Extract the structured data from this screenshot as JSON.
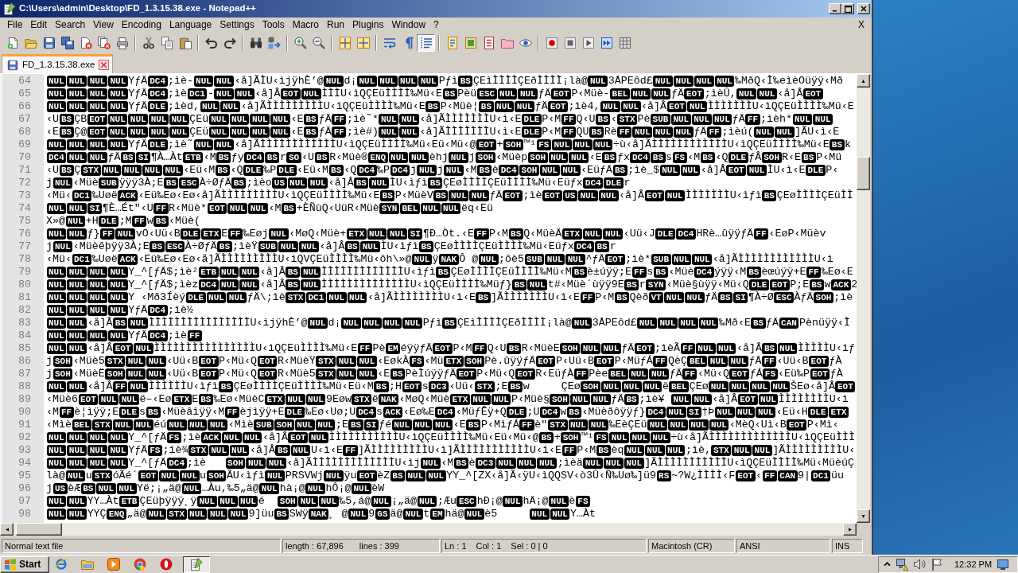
{
  "window": {
    "title": "C:\\Users\\admin\\Desktop\\FD_1.3.15.38.exe - Notepad++"
  },
  "menu": {
    "items": [
      {
        "label": "File"
      },
      {
        "label": "Edit"
      },
      {
        "label": "Search"
      },
      {
        "label": "View"
      },
      {
        "label": "Encoding"
      },
      {
        "label": "Language"
      },
      {
        "label": "Settings"
      },
      {
        "label": "Tools"
      },
      {
        "label": "Macro"
      },
      {
        "label": "Run"
      },
      {
        "label": "Plugins"
      },
      {
        "label": "Window"
      },
      {
        "label": "?"
      }
    ],
    "close_label": "X"
  },
  "toolbar": [
    [
      {
        "on": false
      },
      {
        "on": false
      },
      {
        "on": false
      },
      {
        "on": false
      },
      {
        "on": false
      },
      {
        "on": false
      },
      {
        "on": false
      }
    ],
    [
      {
        "on": false
      },
      {
        "on": false
      },
      {
        "on": false
      }
    ],
    [
      {
        "on": false
      },
      {
        "on": false
      }
    ],
    [
      {
        "on": false
      },
      {
        "on": false
      }
    ],
    [
      {
        "on": false
      },
      {
        "on": false
      }
    ],
    [
      {
        "on": false
      },
      {
        "on": false
      }
    ],
    [
      {
        "on": false
      },
      {
        "on": false
      },
      {
        "on": true
      }
    ],
    [
      {
        "on": false
      },
      {
        "on": false
      },
      {
        "on": false
      },
      {
        "on": false
      },
      {
        "on": false
      }
    ],
    [
      {
        "on": false
      },
      {
        "on": false
      },
      {
        "on": false
      },
      {
        "on": false
      },
      {
        "on": false
      }
    ]
  ],
  "tabs": [
    {
      "label": "FD_1.3.15.38.exe",
      "selected": true
    }
  ],
  "editor": {
    "lines": [
      {
        "number": "64",
        "parts": [
          [
            "NUL",
            "NUL",
            "NUL",
            "NUL"
          ],
          "YƒÄ",
          [
            "DC4"
          ],
          ";ìè-",
          [
            "NUL",
            "NUL"
          ],
          "‹å]ÃÌU‹ìjÿhÈ’@",
          [
            "NUL"
          ],
          "d¡",
          [
            "NUL",
            "NUL",
            "NUL",
            "NUL"
          ],
          "Pƒì",
          [
            "BS"
          ],
          "ÇEìÌÌÌÌÇEðÌÌÌÌ¡là@",
          [
            "NUL"
          ],
          "3ÅPEôd£",
          [
            "NUL",
            "NUL",
            "NUL",
            "NUL"
          ],
          "‰MðQ‹Ì‰eìèOüÿÿ‹Mð"
        ]
      },
      {
        "number": "65",
        "parts": [
          [
            "NUL",
            "NUL",
            "NUL",
            "NUL"
          ],
          "YƒÄ",
          [
            "DC4"
          ],
          ";ìè",
          [
            "DC1"
          ],
          "-",
          [
            "NUL",
            "NUL"
          ],
          "‹å]Â",
          [
            "EOT",
            "NUL"
          ],
          "ÌÌÌU‹ìQÇEüÌÌÌÌ‰Mü‹E",
          [
            "BS"
          ],
          "Pèü",
          [
            "ESC",
            "NUL",
            "NUL"
          ],
          "ƒÄ",
          [
            "EOT"
          ],
          "P‹Müè-",
          [
            "BEL",
            "NUL",
            "NUL"
          ],
          "ƒÄ",
          [
            "EOT"
          ],
          ";ìèÛ,",
          [
            "NUL",
            "NUL"
          ],
          "‹å]Â",
          [
            "EOT"
          ]
        ]
      },
      {
        "number": "66",
        "parts": [
          [
            "NUL",
            "NUL",
            "NUL",
            "NUL"
          ],
          "YƒÄ",
          [
            "DLE"
          ],
          ";ìèd,",
          [
            "NUL",
            "NUL"
          ],
          "‹å]ÃÌÌÌÌÌÌÌÌÌU‹ìQÇEüÌÌÌÌ‰Mü‹E",
          [
            "BS"
          ],
          "P‹Müè¦",
          [
            "BS",
            "NUL",
            "NUL"
          ],
          "ƒÄ",
          [
            "EOT"
          ],
          ";ìè4,",
          [
            "NUL",
            "NUL"
          ],
          "‹å]Â",
          [
            "EOT",
            "NUL"
          ],
          "ÌÌÌÌÌÌÌU‹ìQÇEüÌÌÌÌ‰Mü‹E"
        ]
      },
      {
        "number": "67",
        "parts": [
          "‹U",
          [
            "BS"
          ],
          "ÇB",
          [
            "EOT",
            "NUL",
            "NUL",
            "NUL",
            "NUL"
          ],
          "ÇEü",
          [
            "NUL",
            "NUL",
            "NUL",
            "NUL"
          ],
          "‹E",
          [
            "BS"
          ],
          "ƒÄ",
          [
            "FF"
          ],
          ";ìè˜*",
          [
            "NUL",
            "NUL"
          ],
          "‹å]ÃÌÌÌÌÌÌÌU‹ì‹E",
          [
            "DLE"
          ],
          "P‹M",
          [
            "FF"
          ],
          "Q‹U",
          [
            "BS"
          ],
          "‹",
          [
            "STX"
          ],
          "Pè",
          [
            "SUB",
            "NUL",
            "NUL",
            "NUL"
          ],
          "ƒÄ",
          [
            "FF"
          ],
          ";ìèh*",
          [
            "NUL",
            "NUL"
          ]
        ]
      },
      {
        "number": "68",
        "parts": [
          "‹E",
          [
            "BS"
          ],
          "Ç@",
          [
            "EOT",
            "NUL",
            "NUL",
            "NUL",
            "NUL"
          ],
          "ÇEü",
          [
            "NUL",
            "NUL",
            "NUL",
            "NUL"
          ],
          "‹E",
          [
            "BS"
          ],
          "ƒÄ",
          [
            "FF"
          ],
          ";ìè#)",
          [
            "NUL",
            "NUL"
          ],
          "‹å]ÃÌÌÌÌÌÌÌU‹ì‹E",
          [
            "DLE"
          ],
          "P‹M",
          [
            "FF"
          ],
          "QU",
          [
            "BS"
          ],
          "Rè",
          [
            "FF",
            "NUL",
            "NUL",
            "NUL"
          ],
          "ƒÄ",
          [
            "FF"
          ],
          ";ìèú(",
          [
            "NUL",
            "NUL"
          ],
          "]ÃU‹ì‹E"
        ]
      },
      {
        "number": "69",
        "parts": [
          [
            "NUL",
            "NUL",
            "NUL",
            "NUL"
          ],
          "YƒÄ",
          [
            "DLE"
          ],
          ";ìè˜",
          [
            "NUL",
            "NUL"
          ],
          "‹å]ÃÌÌÌÌÌÌÌÌÌÌÌÌU‹ìQÇEüÌÌÌÌ‰Mü‹Eü‹Mü‹@",
          [
            "EOT"
          ],
          "+",
          [
            "SOH"
          ],
          "™¹",
          [
            "FS",
            "NUL",
            "NUL",
            "NUL"
          ],
          "÷ù‹å]ÃÌÌÌÌÌÌÌÌÌÌÌÌU‹ìQÇEüÌÌÌÌ‰Mü‹E",
          [
            "BS"
          ],
          "k"
        ]
      },
      {
        "number": "70",
        "parts": [
          [
            "DC4",
            "NUL",
            "NUL"
          ],
          "ƒÄ",
          [
            "BS",
            "SI"
          ],
          "¶À…Àt",
          [
            "ETB"
          ],
          "‹M",
          [
            "BS"
          ],
          "ƒy",
          [
            "DC4",
            "BS"
          ],
          "r",
          [
            "SO"
          ],
          "‹U",
          [
            "BS"
          ],
          "R‹Müè®",
          [
            "ENQ",
            "NUL",
            "NUL"
          ],
          "èhj",
          [
            "NUL"
          ],
          "j",
          [
            "SOH"
          ],
          "‹Müèp",
          [
            "SOH",
            "NUL",
            "NUL"
          ],
          "‹E",
          [
            "BS"
          ],
          "ƒx",
          [
            "DC4",
            "BS"
          ],
          "s",
          [
            "FS"
          ],
          "‹M",
          [
            "BS"
          ],
          "‹Q",
          [
            "DLE"
          ],
          "ƒÂ",
          [
            "SOH"
          ],
          "R‹E",
          [
            "BS"
          ],
          "P‹Mü"
        ]
      },
      {
        "number": "71",
        "parts": [
          "‹U",
          [
            "BS"
          ],
          "Ç",
          [
            "STX",
            "NUL",
            "NUL",
            "NUL",
            "NUL"
          ],
          "‹Eü‹M",
          [
            "BS"
          ],
          "‹Q",
          [
            "DLE"
          ],
          "‰P",
          [
            "DLE"
          ],
          "‹Eü‹M",
          [
            "BS"
          ],
          "‹Q",
          [
            "DC4"
          ],
          "‰P",
          [
            "DC4"
          ],
          "j",
          [
            "NUL"
          ],
          "j",
          [
            "NUL"
          ],
          "‹M",
          [
            "BS"
          ],
          "è",
          [
            "DC4",
            "SOH",
            "NUL",
            "NUL"
          ],
          "‹EüƒÄ",
          [
            "BS"
          ],
          ";ìè_$",
          [
            "NUL",
            "NUL"
          ],
          "‹å]Â",
          [
            "EOT",
            "NUL"
          ],
          "ÌU‹ì‹E",
          [
            "DLE"
          ],
          "P‹"
        ]
      },
      {
        "number": "72",
        "parts": [
          "j",
          [
            "NUL"
          ],
          "‹Müè",
          [
            "SUB"
          ],
          "ÿÿÿ3À;E",
          [
            "BS",
            "ESC"
          ],
          "À÷ØƒÄ",
          [
            "BS"
          ],
          ";ìèo",
          [
            "US",
            "NUL",
            "NUL"
          ],
          "‹å]Â",
          [
            "BS",
            "NUL"
          ],
          "ÌU‹ìƒì",
          [
            "BS"
          ],
          "ÇEøÌÌÌÌÇEüÌÌÌÌ‰Mü‹Eüƒx",
          [
            "DC4",
            "DLE"
          ],
          "r"
        ]
      },
      {
        "number": "73",
        "parts": [
          "‹Mü‹",
          [
            "DC1"
          ],
          "‰Uøë",
          [
            "ACK"
          ],
          "‹Eü‰Eø‹Eø‹å]ÃÌÌÌÌÌÌÌÌÌU‹ìQÇEüÌÌÌÌ‰Mü‹E",
          [
            "BS"
          ],
          "P‹MüèV",
          [
            "BS",
            "NUL",
            "NUL"
          ],
          "ƒÄ",
          [
            "EOT"
          ],
          ";ìè",
          [
            "EOT",
            "US",
            "NUL",
            "NUL"
          ],
          "‹å]Â",
          [
            "EOT",
            "NUL"
          ],
          "ÌÌÌÌÌÌÌU‹ìƒì",
          [
            "BS"
          ],
          "ÇEøÌÌÌÌÇEüÌÌ"
        ]
      },
      {
        "number": "74",
        "parts": [
          [
            "NUL",
            "NUL",
            "SI"
          ],
          "¶È…Ét\"‹U",
          [
            "FF"
          ],
          "R‹Müè*",
          [
            "EOT",
            "NUL",
            "NUL"
          ],
          "‹M",
          [
            "BS"
          ],
          "+ÈÑùQ‹UüR‹Müè",
          [
            "SYN",
            "BEL",
            "NUL",
            "NUL"
          ],
          "ëq‹Eü"
        ]
      },
      {
        "number": "75",
        "parts": [
          "X»@",
          [
            "NUL"
          ],
          "+H",
          [
            "DLE"
          ],
          ";M",
          [
            "FF"
          ],
          "w",
          [
            "BS"
          ],
          "‹Müè("
        ]
      },
      {
        "number": "76",
        "parts": [
          [
            "NUL",
            "NUL"
          ],
          "ƒ}",
          [
            "FF",
            "NUL"
          ],
          "vO‹Uü‹B",
          [
            "DLE",
            "ETX"
          ],
          "E",
          [
            "FF"
          ],
          "‰Eøj",
          [
            "NUL"
          ],
          "‹MøQ‹Müè+",
          [
            "ETX",
            "NUL",
            "NUL",
            "SI"
          ],
          "¶Ð…Òt.‹E",
          [
            "FF"
          ],
          "P‹M",
          [
            "BS"
          ],
          "Q‹MüèÄ",
          [
            "ETX",
            "NUL",
            "NUL"
          ],
          "‹Uü‹J",
          [
            "DLE",
            "DC4"
          ],
          "HRè…ûÿÿƒÄ",
          [
            "FF"
          ],
          "‹EøP‹Müèv"
        ]
      },
      {
        "number": "77",
        "parts": [
          "j",
          [
            "NUL"
          ],
          "‹Müèêþÿÿ3À;E",
          [
            "BS",
            "ESC"
          ],
          "À÷ØƒÄ",
          [
            "BS"
          ],
          ";ìèŸ",
          [
            "SUB",
            "NUL",
            "NUL"
          ],
          "‹å]Â",
          [
            "BS",
            "NUL"
          ],
          "ÌU‹ìƒì",
          [
            "BS"
          ],
          "ÇEøÌÌÌÌÇEüÌÌÌÌ‰Mü‹Eüƒx",
          [
            "DC4",
            "BS"
          ],
          "r"
        ]
      },
      {
        "number": "78",
        "parts": [
          "‹Mü‹",
          [
            "DC1"
          ],
          "‰Uøë",
          [
            "ACK"
          ],
          "‹Eü‰Eø‹Eø‹å]ÃÌÌÌÌÌÌÌÌÌU‹ìQVÇEüÌÌÌÌ‰Mü‹ôh\\»@",
          [
            "NUL"
          ],
          "ÿ",
          [
            "NAK"
          ],
          "Ô @",
          [
            "NUL"
          ],
          ";ôè5",
          [
            "SUB",
            "NUL",
            "NUL"
          ],
          "^ƒÄ",
          [
            "EOT"
          ],
          ";ìè*",
          [
            "SUB",
            "NUL",
            "NUL"
          ],
          "‹å]ÃÌÌÌÌÌÌÌÌÌÌÌÌU‹ì"
        ]
      },
      {
        "number": "79",
        "parts": [
          [
            "NUL",
            "NUL",
            "NUL",
            "NUL"
          ],
          "Y_^[ƒÄ$;ìè²",
          [
            "ETB",
            "NUL",
            "NUL"
          ],
          "‹å]Â",
          [
            "BS",
            "NUL"
          ],
          "ÌÌÌÌÌÌÌÌÌÌÌÌÌU‹ìƒì",
          [
            "BS"
          ],
          "ÇEøÌÌÌÌÇEüÌÌÌÌ‰Mü‹M",
          [
            "BS"
          ],
          "è±úÿÿ;E",
          [
            "FF"
          ],
          "s",
          [
            "BS"
          ],
          "‹Müè",
          [
            "DC4"
          ],
          "ýÿÿ‹M",
          [
            "BS"
          ],
          "èœúÿÿ+E",
          [
            "FF"
          ],
          "‰Eø‹E"
        ]
      },
      {
        "number": "80",
        "parts": [
          [
            "NUL",
            "NUL",
            "NUL",
            "NUL"
          ],
          "Y_^[ƒÄ$;ìèz",
          [
            "DC4",
            "NUL",
            "NUL"
          ],
          "‹å]Â",
          [
            "BS",
            "NUL"
          ],
          "ÌÌÌÌÌÌÌÌÌÌÌÌÌÌU‹ìQÇEüÌÌÌÌ‰Müƒ}",
          [
            "BS",
            "NUL"
          ],
          "t#‹Müè´ùÿÿ9E",
          [
            "BS"
          ],
          "r",
          [
            "SYN"
          ],
          "‹Müè§ùÿÿ‹Mü‹Q",
          [
            "DLE",
            "EOT"
          ],
          "P;E",
          [
            "BS"
          ],
          "w",
          [
            "ACK"
          ],
          "2"
        ]
      },
      {
        "number": "81",
        "parts": [
          [
            "NUL",
            "NUL",
            "NUL",
            "NUL"
          ],
          "Y ‹Mð3Íèý",
          [
            "DLE",
            "NUL",
            "NUL"
          ],
          "ƒÄ\\;ìè",
          [
            "STX",
            "DC1",
            "NUL",
            "NUL"
          ],
          "‹å]ÃÌÌÌÌÌÌÌÌU‹ì‹E",
          [
            "BS"
          ],
          "]ÃÌÌÌÌÌÌÌU‹ì‹E",
          [
            "FF"
          ],
          "P‹M",
          [
            "BS"
          ],
          "Qèð",
          [
            "VT",
            "NUL",
            "NUL"
          ],
          "ƒÄ",
          [
            "BS",
            "SI"
          ],
          "¶À÷Ø",
          [
            "ESC"
          ],
          "ÀƒÄ",
          [
            "SOH"
          ],
          ";ìè"
        ]
      },
      {
        "number": "82",
        "parts": [
          [
            "NUL",
            "NUL",
            "NUL",
            "NUL"
          ],
          "YƒÄ",
          [
            "DC4"
          ],
          ";ìè½"
        ]
      },
      {
        "number": "83",
        "parts": [
          [
            "NUL",
            "NUL"
          ],
          "‹å]Â",
          [
            "BS",
            "NUL"
          ],
          "ÌÌÌÌÌÌÌÌÌÌÌÌÌÌÌÌU‹ìjÿhÈ’@",
          [
            "NUL"
          ],
          "d¡",
          [
            "NUL",
            "NUL",
            "NUL",
            "NUL"
          ],
          "Pƒì",
          [
            "BS"
          ],
          "ÇEìÌÌÌÌÇEðÌÌÌÌ¡là@",
          [
            "NUL"
          ],
          "3ÅPEôd£",
          [
            "NUL",
            "NUL",
            "NUL",
            "NUL"
          ],
          "‰Mð‹E",
          [
            "BS"
          ],
          "ƒÄ",
          [
            "CAN"
          ],
          "Pènüÿÿ‹Ì"
        ]
      },
      {
        "number": "84",
        "parts": [
          [
            "NUL",
            "NUL",
            "NUL",
            "NUL"
          ],
          "YƒÄ",
          [
            "DC4"
          ],
          ";ìè",
          [
            "FF"
          ]
        ]
      },
      {
        "number": "85",
        "parts": [
          [
            "NUL",
            "NUL"
          ],
          "‹å]Â",
          [
            "EOT",
            "NUL"
          ],
          "ÌÌÌÌÌÌÌÌÌÌÌÌÌÌÌÌU‹ìQÇEüÌÌÌÌ‰Mü‹E",
          [
            "FF"
          ],
          "Pè",
          [
            "EM"
          ],
          "éÿÿƒÄ",
          [
            "EOT"
          ],
          "P‹M",
          [
            "FF"
          ],
          "Q‹U",
          [
            "BS"
          ],
          "R‹MüèE",
          [
            "SOH",
            "NUL",
            "NUL"
          ],
          "ƒÄ",
          [
            "EOT"
          ],
          ";ìèÃ",
          [
            "FF",
            "NUL",
            "NUL"
          ],
          "‹å]Â",
          [
            "BS",
            "NUL"
          ],
          "ÌÌÌÌÌU‹ìƒ"
        ]
      },
      {
        "number": "86",
        "parts": [
          "j",
          [
            "SOH"
          ],
          "‹Müè5",
          [
            "STX",
            "NUL",
            "NUL"
          ],
          "‹Uü‹B",
          [
            "EOT"
          ],
          "P‹Mü‹Q",
          [
            "EOT"
          ],
          "R‹MüèŸ",
          [
            "STX",
            "NUL",
            "NUL"
          ],
          "‹EøkÀ",
          [
            "FS"
          ],
          "‹Mü",
          [
            "ETX",
            "SOH"
          ],
          "Pè.ûÿÿƒÄ",
          [
            "EOT"
          ],
          "P‹Uü‹B",
          [
            "EOT"
          ],
          "P‹MüƒÁ",
          [
            "FF"
          ],
          "QèÇ",
          [
            "BEL",
            "NUL",
            "NUL"
          ],
          "ƒÄ",
          [
            "FF"
          ],
          "‹Uü‹B",
          [
            "EOT"
          ],
          "ƒÀ"
        ]
      },
      {
        "number": "87",
        "parts": [
          "j",
          [
            "SOH"
          ],
          "‹MüèË",
          [
            "SOH",
            "NUL",
            "NUL"
          ],
          "‹Uü‹B",
          [
            "EOT"
          ],
          "P‹Mü‹Q",
          [
            "EOT"
          ],
          "R‹Müè5",
          [
            "STX",
            "NUL",
            "NUL"
          ],
          "‹E",
          [
            "BS"
          ],
          "PèÌúÿÿƒÄ",
          [
            "EOT"
          ],
          "P‹Mü‹Q",
          [
            "EOT"
          ],
          "R‹EüƒÀ",
          [
            "FF"
          ],
          "Pèe",
          [
            "BEL",
            "NUL",
            "NUL"
          ],
          "ƒÄ",
          [
            "FF"
          ],
          "‹Mü‹Q",
          [
            "EOT"
          ],
          "ƒÁ",
          [
            "FS"
          ],
          "‹Eü‰P",
          [
            "EOT"
          ],
          "ƒÀ"
        ]
      },
      {
        "number": "88",
        "parts": [
          [
            "NUL",
            "NUL"
          ],
          "‹å]Â",
          [
            "FF",
            "NUL"
          ],
          "ÌÌÌÌÌÌU‹ìƒì",
          [
            "BS"
          ],
          "ÇEøÌÌÌÌÇEüÌÌÌÌ‰Mü‹Eü‹M",
          [
            "BS"
          ],
          ";H",
          [
            "EOT"
          ],
          "s",
          [
            "DC3"
          ],
          "‹Uü‹",
          [
            "STX"
          ],
          ";E",
          [
            "BS"
          ],
          "w     ÇEø",
          [
            "SOH",
            "NUL",
            "NUL",
            "NUL"
          ],
          "ë",
          [
            "BEL"
          ],
          "ÇEø",
          [
            "NUL",
            "NUL",
            "NUL",
            "NUL"
          ],
          "ŠEø‹å]Â",
          [
            "EOT"
          ]
        ]
      },
      {
        "number": "89",
        "parts": [
          "‹Müè6",
          [
            "EOT",
            "NUL",
            "NUL"
          ],
          "ë–‹Eø",
          [
            "ETX"
          ],
          "E",
          [
            "BS"
          ],
          "‰Eø‹MüèC",
          [
            "ETX",
            "NUL",
            "NUL"
          ],
          "9Eøw",
          [
            "STX"
          ],
          "ë",
          [
            "NAK"
          ],
          "‹MøQ‹Müè",
          [
            "ETX",
            "NUL",
            "NUL"
          ],
          "P‹Müè§",
          [
            "SOH",
            "NUL",
            "NUL"
          ],
          "ƒÄ",
          [
            "BS"
          ],
          ";ìè¥ ",
          [
            "NUL",
            "NUL"
          ],
          "‹å]Â",
          [
            "EOT",
            "NUL"
          ],
          "ÌÌÌÌÌÌÌÌU‹ì"
        ]
      },
      {
        "number": "90",
        "parts": [
          "‹M",
          [
            "FF"
          ],
          "è¦ìÿÿ;E",
          [
            "DLE"
          ],
          "s",
          [
            "BS"
          ],
          "‹Müèâìÿÿ‹M",
          [
            "FF"
          ],
          "èjìÿÿ+E",
          [
            "DLE"
          ],
          "‰Eø‹Uø;U",
          [
            "DC4"
          ],
          "s",
          [
            "ACK"
          ],
          "‹Eø‰E",
          [
            "DC4"
          ],
          "‹MüƒÊÿ+Q",
          [
            "DLE"
          ],
          ";U",
          [
            "DC4"
          ],
          "w",
          [
            "BS"
          ],
          "‹Müèðôÿÿƒ}",
          [
            "DC4",
            "NUL",
            "SI"
          ],
          "†Þ",
          [
            "NUL",
            "NUL",
            "NUL"
          ],
          "‹Eü‹H",
          [
            "DLE",
            "ETX"
          ]
        ]
      },
      {
        "number": "91",
        "parts": [
          "‹Mìè",
          [
            "BEL",
            "STX",
            "NUL",
            "NUL"
          ],
          "éú",
          [
            "NUL",
            "NUL",
            "NUL"
          ],
          "‹Mìè",
          [
            "SUB",
            "SOH",
            "NUL",
            "NUL"
          ],
          ";E",
          [
            "BS",
            "SI"
          ],
          "ƒé",
          [
            "NUL",
            "NUL",
            "NUL"
          ],
          "‹E",
          [
            "BS"
          ],
          "P‹MìƒÁ",
          [
            "FF"
          ],
          "è\"",
          [
            "STX",
            "NUL",
            "NUL"
          ],
          "‰EèÇEü",
          [
            "NUL",
            "NUL",
            "NUL",
            "NUL"
          ],
          "‹MèQ‹Uì‹B",
          [
            "EOT"
          ],
          "P‹Mì‹"
        ]
      },
      {
        "number": "92",
        "parts": [
          [
            "NUL",
            "NUL",
            "NUL",
            "NUL"
          ],
          "Y_^[ƒÄ",
          [
            "FS"
          ],
          ";ìè",
          [
            "ACK",
            "NUL",
            "NUL"
          ],
          "‹å]Â",
          [
            "EOT",
            "NUL"
          ],
          "ÌÌÌÌÌÌÌÌÌÌÌU‹ìQÇEüÌÌÌÌ‰Mü‹Eü‹Mü‹@",
          [
            "BS"
          ],
          "+",
          [
            "SOH"
          ],
          "™¹",
          [
            "FS",
            "NUL",
            "NUL",
            "NUL"
          ],
          "÷ù‹å]ÃÌÌÌÌÌÌÌÌÌÌÌÌÌU‹ìQÇEüÌÌÌ"
        ]
      },
      {
        "number": "93",
        "parts": [
          [
            "NUL",
            "NUL",
            "NUL",
            "NUL"
          ],
          "YƒÄ",
          [
            "FS"
          ],
          ";ìè¾",
          [
            "STX",
            "NUL",
            "NUL"
          ],
          "‹å]Â",
          [
            "BS",
            "NUL"
          ],
          "U‹ì‹E",
          [
            "FF"
          ],
          "]ÃÌÌÌÌÌÌÌÌÌU‹ì]ÃÌÌÌÌÌÌÌÌÌÌÌU‹ì‹E",
          [
            "FF"
          ],
          "P‹M",
          [
            "BS"
          ],
          "èq",
          [
            "NUL",
            "NUL",
            "NUL"
          ],
          ";ìè,",
          [
            "STX",
            "NUL",
            "NUL"
          ],
          "]ÃÌÌÌÌÌÌÌÌÌU‹"
        ]
      },
      {
        "number": "94",
        "parts": [
          [
            "NUL",
            "NUL",
            "NUL",
            "NUL"
          ],
          "Y_^[ƒÄ",
          [
            "DC4"
          ],
          ";ìè   ",
          [
            "SOH",
            "NUL",
            "NUL"
          ],
          "‹å]ÃÌÌÌÌÌÌÌÌÌÌÌÌÌU‹ìj",
          [
            "NUL"
          ],
          "‹M",
          [
            "BS"
          ],
          "è",
          [
            "DC3",
            "NUL",
            "NUL",
            "NUL"
          ],
          ";ìèä",
          [
            "NUL",
            "NUL",
            "NUL"
          ],
          "]ÃÌÌÌÌÌÌÌÌÌÌÌU‹ìQÇEüÌÌÌÌ‰Mü‹MüèúÇ"
        ]
      },
      {
        "number": "95",
        "parts": [
          "là@",
          [
            "NUL"
          ],
          "u",
          [
            "STX"
          ],
          "óÃé´",
          [
            "EOT",
            "NUL",
            "NUL"
          ],
          "u",
          [
            "SOH"
          ],
          "ÃU‹ìƒì",
          [
            "NUL"
          ],
          "PRSVWj",
          [
            "NUL"
          ],
          "ÿu",
          [
            "EOT"
          ],
          "èZ",
          [
            "BS",
            "NUL",
            "NUL"
          ],
          "YY_^[ZX‹å]Ã",
          "‹ÿU‹ìQQSV‹ò3Û‹Ñ‰Uø‰]ü9",
          [
            "RS"
          ],
          "~?W¿ÌÌÌÌ‹F",
          [
            "EOT"
          ],
          "‹",
          [
            "FF",
            "CAN"
          ],
          "9|",
          [
            "DC1"
          ],
          "üu"
        ]
      },
      {
        "number": "96",
        "parts": [
          "j",
          [
            "US"
          ],
          "èÆ",
          [
            "BS",
            "NUL",
            "NUL"
          ],
          "Yë;¡„ä@",
          [
            "NUL"
          ],
          "…Àu,‰5„ä@",
          [
            "NUL"
          ],
          "hà¡@",
          [
            "NUL"
          ],
          "hÔ¡@",
          [
            "NUL"
          ],
          "èW"
        ]
      },
      {
        "number": "97",
        "parts": [
          [
            "NUL",
            "NUL"
          ],
          "YY…Àt",
          [
            "ETB"
          ],
          "ÇEüþÿÿÿ¸ÿ",
          [
            "NUL",
            "NUL",
            "NUL"
          ],
          "é  ",
          [
            "SOH",
            "NUL",
            "NUL"
          ],
          "‰5,á@",
          [
            "NUL"
          ],
          "¡„ä@",
          [
            "NUL"
          ],
          ";Æu",
          [
            "ESC"
          ],
          "hÐ¡@",
          [
            "NUL"
          ],
          "hÄ¡@",
          [
            "NUL"
          ],
          "è",
          [
            "FS"
          ]
        ]
      },
      {
        "number": "98",
        "parts": [
          [
            "NUL",
            "NUL"
          ],
          "YYÇ",
          [
            "ENQ"
          ],
          "„ä@",
          [
            "NUL",
            "STX",
            "NUL",
            "NUL",
            "NUL"
          ],
          "9]üu",
          [
            "BS"
          ],
          "SWÿ",
          [
            "NAK"
          ],
          "¸ @",
          [
            "NUL"
          ],
          "9",
          [
            "GS"
          ],
          "ä@",
          [
            "NUL"
          ],
          "t",
          [
            "EM"
          ],
          "hä@",
          [
            "NUL"
          ],
          "è5     ",
          [
            "NUL",
            "NUL"
          ],
          "Y…Àt"
        ]
      }
    ]
  },
  "status_bar": {
    "file_type": "Normal text file",
    "length": "length : 67,896",
    "line_count": "lines : 399",
    "position": "Ln : 1",
    "column": "Col : 1",
    "selection": "Sel : 0 | 0",
    "line_ending": "Macintosh (CR)",
    "encoding": "ANSI",
    "insert_mode": "INS"
  },
  "taskbar": {
    "start": "Start",
    "tasks": [
      {
        "selected": true
      }
    ],
    "clock": "12:32 PM"
  }
}
